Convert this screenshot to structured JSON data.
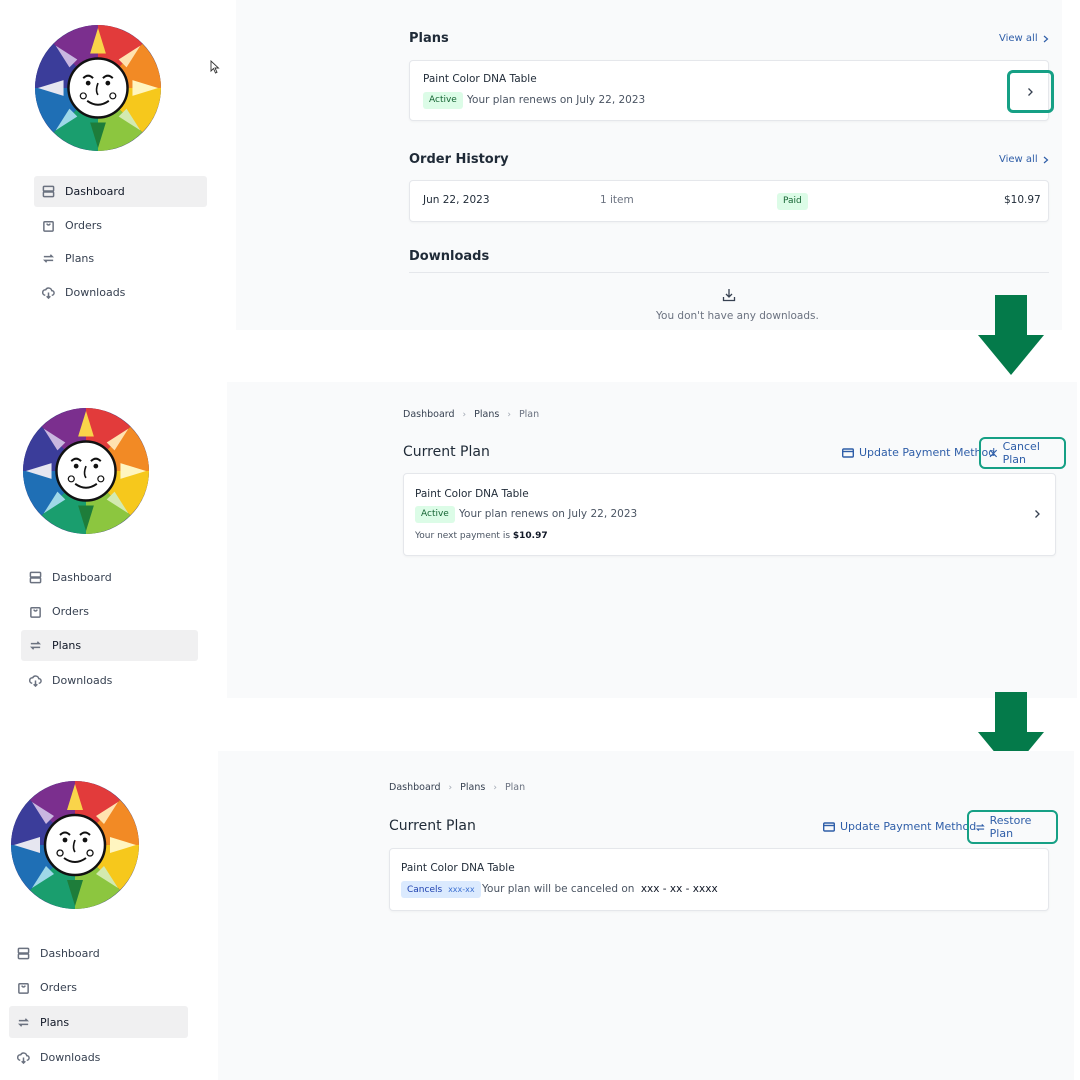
{
  "nav": {
    "dashboard": "Dashboard",
    "orders": "Orders",
    "plans": "Plans",
    "downloads": "Downloads"
  },
  "screen1": {
    "plans_title": "Plans",
    "view_all": "View all",
    "plan_name": "Paint Color DNA Table",
    "status": "Active",
    "renew_text": "Your plan renews on July 22, 2023",
    "order_history_title": "Order History",
    "order": {
      "date": "Jun 22, 2023",
      "items": "1 item",
      "status": "Paid",
      "total": "$10.97"
    },
    "downloads_title": "Downloads",
    "downloads_empty": "You don't have any downloads."
  },
  "screen2": {
    "breadcrumb": [
      "Dashboard",
      "Plans",
      "Plan"
    ],
    "title": "Current Plan",
    "update_payment": "Update Payment Method",
    "cancel_plan": "Cancel Plan",
    "plan_name": "Paint Color DNA Table",
    "status": "Active",
    "renew_text": "Your plan renews on July 22, 2023",
    "next_payment_label": "Your next payment is",
    "next_payment_value": "$10.97"
  },
  "screen3": {
    "breadcrumb": [
      "Dashboard",
      "Plans",
      "Plan"
    ],
    "title": "Current Plan",
    "update_payment": "Update Payment Method",
    "restore_plan": "Restore Plan",
    "plan_name": "Paint Color DNA Table",
    "status": "Cancels",
    "status_date": "xxx-xx",
    "cancel_text": "Your plan will be canceled on",
    "cancel_date": "xxx - xx - xxxx"
  },
  "colors": {
    "accent_outline": "#16a085",
    "arrow": "#047a4a",
    "link": "#2f5ea8"
  }
}
